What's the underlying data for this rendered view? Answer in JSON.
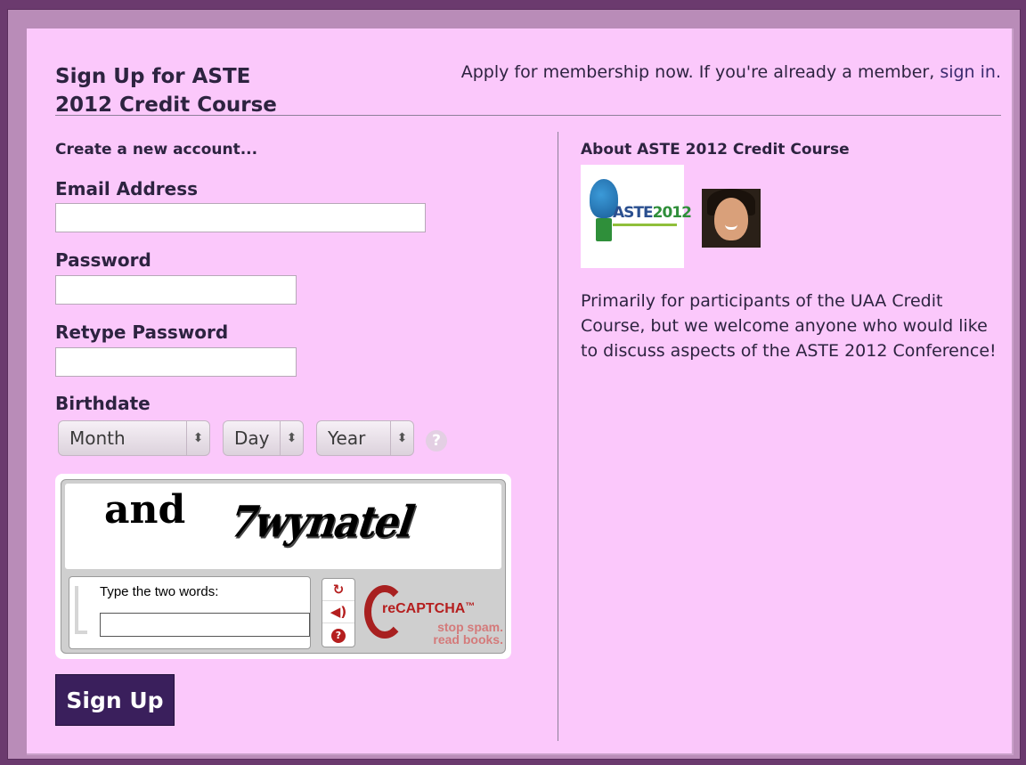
{
  "header": {
    "title": "Sign Up for ASTE 2012 Credit Course",
    "note": "Apply for membership now. If you're already a member,",
    "sign_in_link": "sign in."
  },
  "form": {
    "subtitle": "Create a new account...",
    "email_label": "Email Address",
    "email_value": "",
    "password_label": "Password",
    "password_value": "",
    "retype_label": "Retype Password",
    "retype_value": "",
    "birthdate_label": "Birthdate",
    "month_select": "Month",
    "day_select": "Day",
    "year_select": "Year",
    "help_glyph": "?",
    "submit_label": "Sign Up"
  },
  "captcha": {
    "word1": "and",
    "word2": "7wynatel",
    "prompt": "Type the two words:",
    "value": "",
    "controls": [
      "refresh-icon",
      "audio-icon",
      "help-icon"
    ],
    "brand": "reCAPTCHA",
    "tm": "™",
    "tagline_1": "stop spam.",
    "tagline_2": "read books."
  },
  "about": {
    "title": "About ASTE 2012 Credit Course",
    "logo_text": "ASTE",
    "logo_year": "2012",
    "description": "Primarily for participants of the UAA Credit Course, but we welcome anyone who would like to discuss aspects of the ASTE 2012 Conference!"
  },
  "colors": {
    "page_bg": "#fbc8fb",
    "frame": "#6b3a6e",
    "button": "#3a1f5c",
    "recaptcha_red": "#b51e1e"
  }
}
